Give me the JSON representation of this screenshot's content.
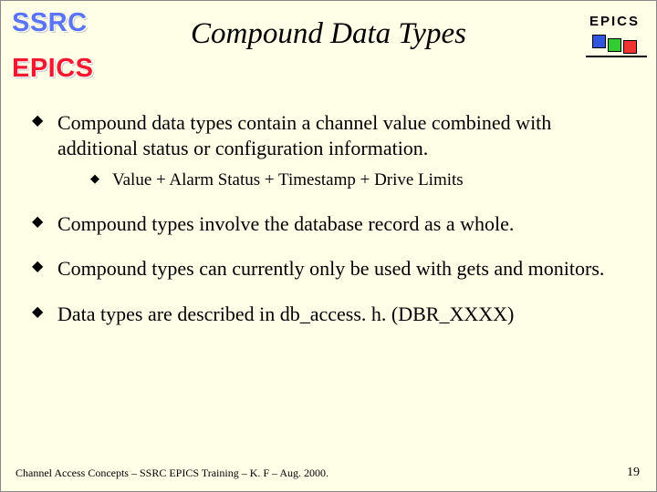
{
  "logos": {
    "ssrc": "SSRC",
    "epics_left": "EPICS",
    "epics_right_label": "EPICS"
  },
  "title": "Compound Data Types",
  "bullets": [
    {
      "text": "Compound data types contain a channel value combined with additional status or configuration information.",
      "sub": [
        "Value + Alarm Status + Timestamp + Drive Limits"
      ]
    },
    {
      "text": "Compound types involve the database record as a whole."
    },
    {
      "text": "Compound types can currently only be used with gets and monitors."
    },
    {
      "text": "Data types are described in db_access. h. (DBR_XXXX)"
    }
  ],
  "footer": "Channel Access Concepts – SSRC EPICS Training – K. F – Aug. 2000.",
  "page_number": "19"
}
